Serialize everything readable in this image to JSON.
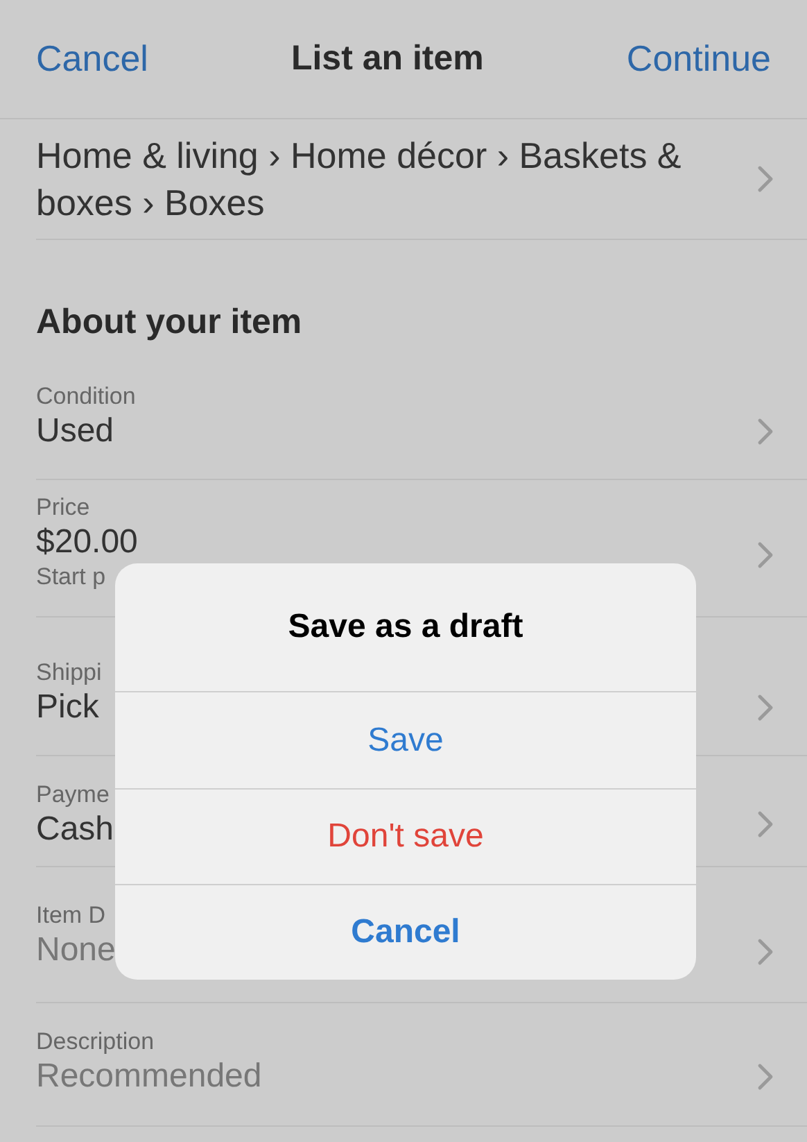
{
  "header": {
    "cancel": "Cancel",
    "title": "List an item",
    "continue": "Continue"
  },
  "category": {
    "value": "Home & living › Home décor › Baskets & boxes › Boxes"
  },
  "section": {
    "title": "About your item"
  },
  "rows": [
    {
      "label": "Condition",
      "value": "Used",
      "muted": false
    },
    {
      "label": "Price",
      "value": "$20.00",
      "note": "Start p",
      "muted": false
    },
    {
      "label": "Shippi",
      "value": "Pick",
      "muted": false
    },
    {
      "label": "Payme",
      "value": "Cash",
      "muted": false
    },
    {
      "label": "Item D",
      "value": "None",
      "muted": true
    },
    {
      "label": "Description",
      "value": "Recommended",
      "muted": true
    }
  ],
  "dialog": {
    "title": "Save as a draft",
    "actions": [
      {
        "label": "Save",
        "kind": "default"
      },
      {
        "label": "Don't save",
        "kind": "destructive"
      },
      {
        "label": "Cancel",
        "kind": "cancel"
      }
    ]
  }
}
